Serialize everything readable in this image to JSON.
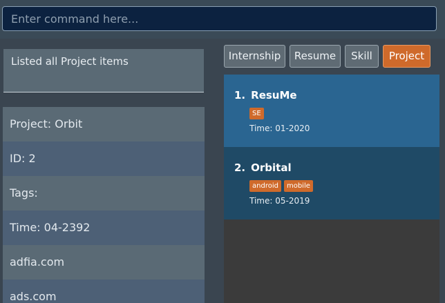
{
  "command": {
    "placeholder": "Enter command here..."
  },
  "result_message": "Listed all Project items",
  "detail": {
    "rows": [
      "Project: Orbit",
      "ID: 2",
      "Tags:",
      "Time: 04-2392",
      "adfia.com",
      "ads.com"
    ]
  },
  "tabs": [
    {
      "label": "Internship",
      "active": false
    },
    {
      "label": "Resume",
      "active": false
    },
    {
      "label": "Skill",
      "active": false
    },
    {
      "label": "Project",
      "active": true
    }
  ],
  "items": [
    {
      "number": "1.",
      "name": "ResuMe",
      "tags": [
        "SE"
      ],
      "time": "Time: 01-2020"
    },
    {
      "number": "2.",
      "name": "Orbital",
      "tags": [
        "android",
        "mobile"
      ],
      "time": "Time: 05-2019"
    }
  ],
  "colors": {
    "accent": "#cf6a2b",
    "selected_card": "#2a6591",
    "card": "#1f4a66",
    "command_bg": "#0c2240"
  }
}
